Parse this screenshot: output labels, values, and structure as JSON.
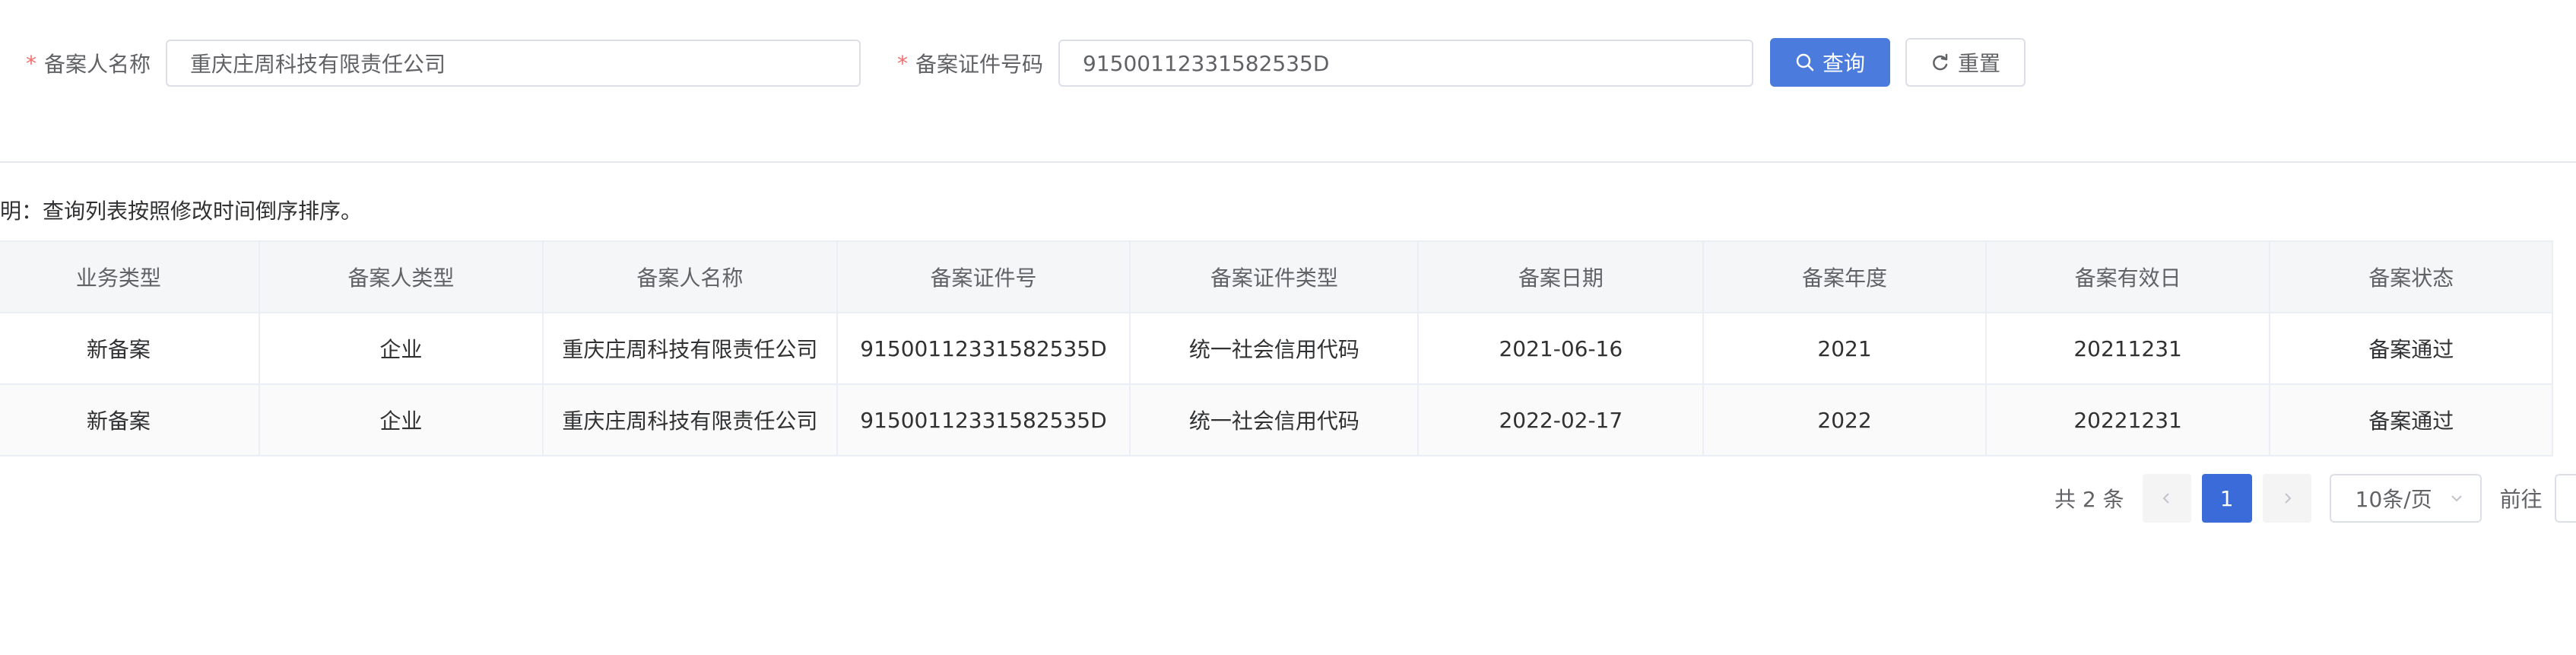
{
  "search_form": {
    "name_field": {
      "required_mark": "*",
      "label": "备案人名称",
      "value": "重庆庄周科技有限责任公司"
    },
    "cert_field": {
      "required_mark": "*",
      "label": "备案证件号码",
      "value": "91500112331582535D"
    },
    "query_button": {
      "icon": "search-icon",
      "label": "查询"
    },
    "reset_button": {
      "icon": "refresh-icon",
      "label": "重置"
    }
  },
  "note": "明：查询列表按照修改时间倒序排序。",
  "table": {
    "columns": [
      "业务类型",
      "备案人类型",
      "备案人名称",
      "备案证件号",
      "备案证件类型",
      "备案日期",
      "备案年度",
      "备案有效日",
      "备案状态"
    ],
    "rows": [
      [
        "新备案",
        "企业",
        "重庆庄周科技有限责任公司",
        "91500112331582535D",
        "统一社会信用代码",
        "2021-06-16",
        "2021",
        "20211231",
        "备案通过"
      ],
      [
        "新备案",
        "企业",
        "重庆庄周科技有限责任公司",
        "91500112331582535D",
        "统一社会信用代码",
        "2022-02-17",
        "2022",
        "20221231",
        "备案通过"
      ]
    ]
  },
  "pagination": {
    "total_text": "共 2 条",
    "current_page": "1",
    "page_size": "10条/页",
    "goto_label": "前往"
  },
  "colors": {
    "primary": "#4a7bdd",
    "active_page": "#3a6bd8",
    "required": "#f56c6c",
    "header_bg": "#f5f6f8"
  }
}
